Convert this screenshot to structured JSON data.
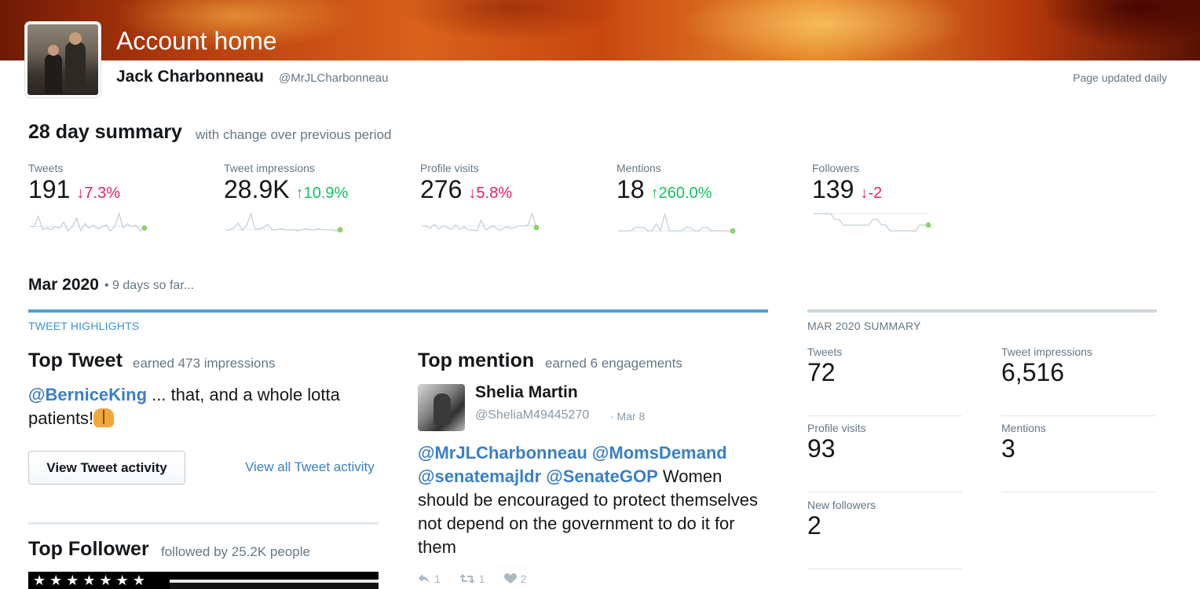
{
  "header": {
    "title": "Account home",
    "user_name": "Jack Charbonneau",
    "user_handle": "@MrJLCharbonneau",
    "updated": "Page updated daily"
  },
  "summary": {
    "title": "28 day summary",
    "subtitle": "with change over previous period",
    "metrics": [
      {
        "label": "Tweets",
        "value": "191",
        "change": "7.3%",
        "direction": "down",
        "arrow": "↓"
      },
      {
        "label": "Tweet impressions",
        "value": "28.9K",
        "change": "10.9%",
        "direction": "up",
        "arrow": "↑"
      },
      {
        "label": "Profile visits",
        "value": "276",
        "change": "5.8%",
        "direction": "down",
        "arrow": "↓"
      },
      {
        "label": "Mentions",
        "value": "18",
        "change": "260.0%",
        "direction": "up",
        "arrow": "↑"
      },
      {
        "label": "Followers",
        "value": "139",
        "change": "-2",
        "direction": "down",
        "arrow": "↓"
      }
    ]
  },
  "month": {
    "title": "Mar 2020",
    "subtitle": "• 9 days so far...",
    "highlights_label": "TWEET HIGHLIGHTS",
    "top_tweet": {
      "heading": "Top Tweet",
      "sub": "earned 473 impressions",
      "mention": "@BerniceKing",
      "text": " ... that, and a whole lotta patients!",
      "emoji": "raising-hands-emoji",
      "button": "View Tweet activity",
      "link": "View all Tweet activity"
    },
    "top_mention": {
      "heading": "Top mention",
      "sub": "earned 6 engagements",
      "name": "Shelia Martin",
      "handle": "@SheliaM49445270",
      "date": "· Mar 8",
      "mentions": "@MrJLCharbonneau @MomsDemand @senatemajldr @SenateGOP",
      "text": " Women should be encouraged to protect themselves not depend on the government to do it for them",
      "replies": "1",
      "retweets": "1",
      "likes": "2"
    },
    "top_follower": {
      "heading": "Top Follower",
      "sub": "followed by 25.2K people",
      "banner_stars": "★★★★★★★"
    }
  },
  "side": {
    "label": "MAR 2020 SUMMARY",
    "metrics": [
      {
        "label": "Tweets",
        "value": "72"
      },
      {
        "label": "Tweet impressions",
        "value": "6,516"
      },
      {
        "label": "Profile visits",
        "value": "93"
      },
      {
        "label": "Mentions",
        "value": "3"
      },
      {
        "label": "New followers",
        "value": "2"
      }
    ]
  },
  "colors": {
    "link": "#3b7fc4",
    "down": "#e0245e",
    "up": "#17bf63",
    "accent_rule": "#4aa1e0",
    "sparkline": "#ccd6dd",
    "spark_dot": "#8fd16e"
  },
  "chart_data": [
    {
      "type": "line",
      "series": [
        {
          "values": [
            6,
            6,
            13,
            4,
            5,
            4,
            6,
            5,
            9,
            3,
            6,
            12,
            3,
            8,
            5,
            7,
            4,
            6,
            7,
            3,
            6,
            15,
            5,
            8,
            6,
            7,
            3,
            5
          ]
        }
      ]
    },
    {
      "type": "line",
      "series": [
        {
          "values": [
            3,
            3,
            5,
            9,
            3,
            7,
            18,
            4,
            4,
            5,
            8,
            3,
            3,
            4,
            3,
            3,
            3,
            2,
            3,
            4,
            3,
            3,
            4,
            3,
            3,
            3,
            2,
            3
          ]
        }
      ]
    },
    {
      "type": "line",
      "series": [
        {
          "values": [
            9,
            9,
            6,
            11,
            5,
            9,
            7,
            5,
            10,
            5,
            8,
            4,
            4,
            3,
            16,
            4,
            7,
            9,
            4,
            5,
            8,
            6,
            7,
            9,
            9,
            10,
            24,
            7
          ]
        }
      ]
    },
    {
      "type": "line",
      "series": [
        {
          "values": [
            0,
            0,
            0,
            0,
            1,
            1,
            1,
            0,
            0,
            2,
            0,
            5,
            0,
            0,
            0,
            0,
            1,
            1,
            0,
            0,
            1,
            1,
            0,
            0,
            0,
            0,
            0,
            0
          ]
        }
      ]
    },
    {
      "type": "line",
      "series": [
        {
          "values": [
            141,
            141,
            141,
            141,
            141,
            140,
            140,
            139,
            139,
            139,
            139,
            139,
            139,
            139,
            140,
            140,
            139,
            139,
            138,
            138,
            138,
            138,
            138,
            138,
            138,
            139,
            139,
            139
          ]
        }
      ]
    }
  ]
}
